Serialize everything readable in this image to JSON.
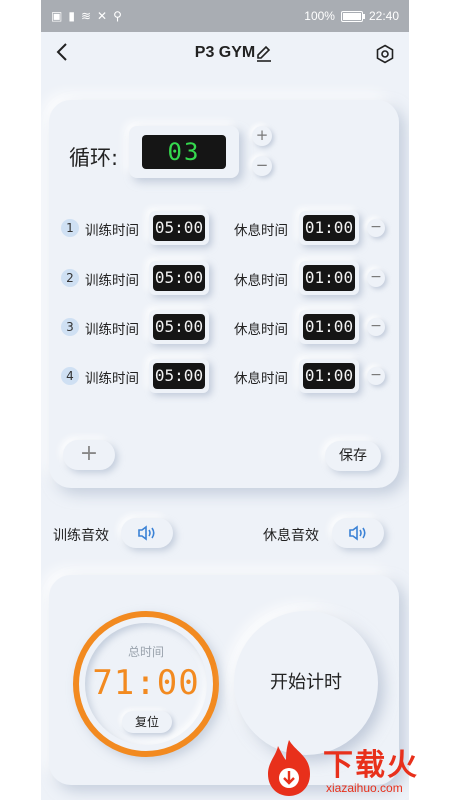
{
  "status_bar": {
    "battery": "100%",
    "time": "22:40"
  },
  "header": {
    "title": "P3 GYM"
  },
  "cycle": {
    "label": "循环:",
    "value": "03",
    "plus": "+",
    "minus": "−"
  },
  "rounds": [
    {
      "num": "1",
      "train_label": "训练时间",
      "train_time": "05:00",
      "rest_label": "休息时间",
      "rest_time": "01:00"
    },
    {
      "num": "2",
      "train_label": "训练时间",
      "train_time": "05:00",
      "rest_label": "休息时间",
      "rest_time": "01:00"
    },
    {
      "num": "3",
      "train_label": "训练时间",
      "train_time": "05:00",
      "rest_label": "休息时间",
      "rest_time": "01:00"
    },
    {
      "num": "4",
      "train_label": "训练时间",
      "train_time": "05:00",
      "rest_label": "休息时间",
      "rest_time": "01:00"
    }
  ],
  "actions": {
    "add": "+",
    "save": "保存",
    "minus": "−"
  },
  "sound": {
    "train_label": "训练音效",
    "rest_label": "休息音效"
  },
  "timer": {
    "total_label": "总时间",
    "total_value": "71:00",
    "reset": "复位",
    "start": "开始计时"
  },
  "watermark": {
    "text": "下载火",
    "sub": "xiazaihuo.com"
  },
  "colors": {
    "accent_orange": "#f28a20",
    "digit_green": "#35d94e",
    "speaker_blue": "#3b82d6",
    "watermark_red": "#e8301b"
  },
  "icons": {
    "back": "chevron-left-icon",
    "edit": "pencil-icon",
    "settings": "hexagon-gear-icon",
    "speaker": "speaker-icon"
  }
}
